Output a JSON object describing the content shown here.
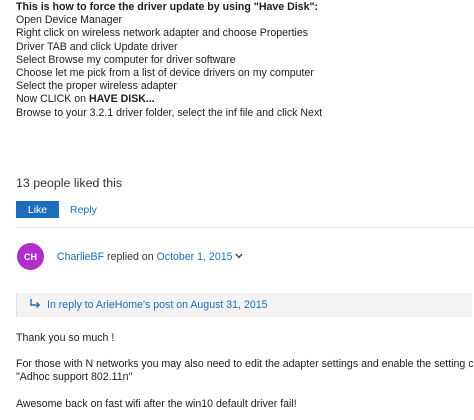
{
  "instructions": {
    "heading": "This is how to force the driver update by using \"Have Disk\":",
    "steps": [
      "Open Device Manager",
      "Right click on wireless network adapter and choose Properties",
      "Driver TAB and click Update driver",
      "Select Browse my computer for driver software",
      "Choose let me pick from a list of device drivers on my computer",
      "Select the proper wireless adapter"
    ],
    "have_disk_prefix": "Now CLICK on ",
    "have_disk_bold": "HAVE DISK...",
    "last_step": "Browse to your 3.2.1 driver folder, select the inf file and click Next"
  },
  "likes": {
    "count_text": "13 people liked this",
    "like_label": "Like",
    "reply_label": "Reply"
  },
  "reply": {
    "avatar_initials": "CH",
    "avatar_color": "#b12fc9",
    "author": "CharlieBF",
    "replied_on": " replied on ",
    "date": "October 1, 2015",
    "in_reply_to": "In reply to ArieHome's post on August 31, 2015",
    "body": [
      "Thank you so much !",
      "For those with N networks you may also need to edit the adapter settings and enable the setting called",
      "\"Adhoc support 802.11n\"",
      "Awesome back on fast wifi after the win10 default driver fail!"
    ]
  },
  "colors": {
    "accent": "#1e6dbb",
    "text": "#1e1e1e",
    "panel": "#f3f3f3"
  }
}
